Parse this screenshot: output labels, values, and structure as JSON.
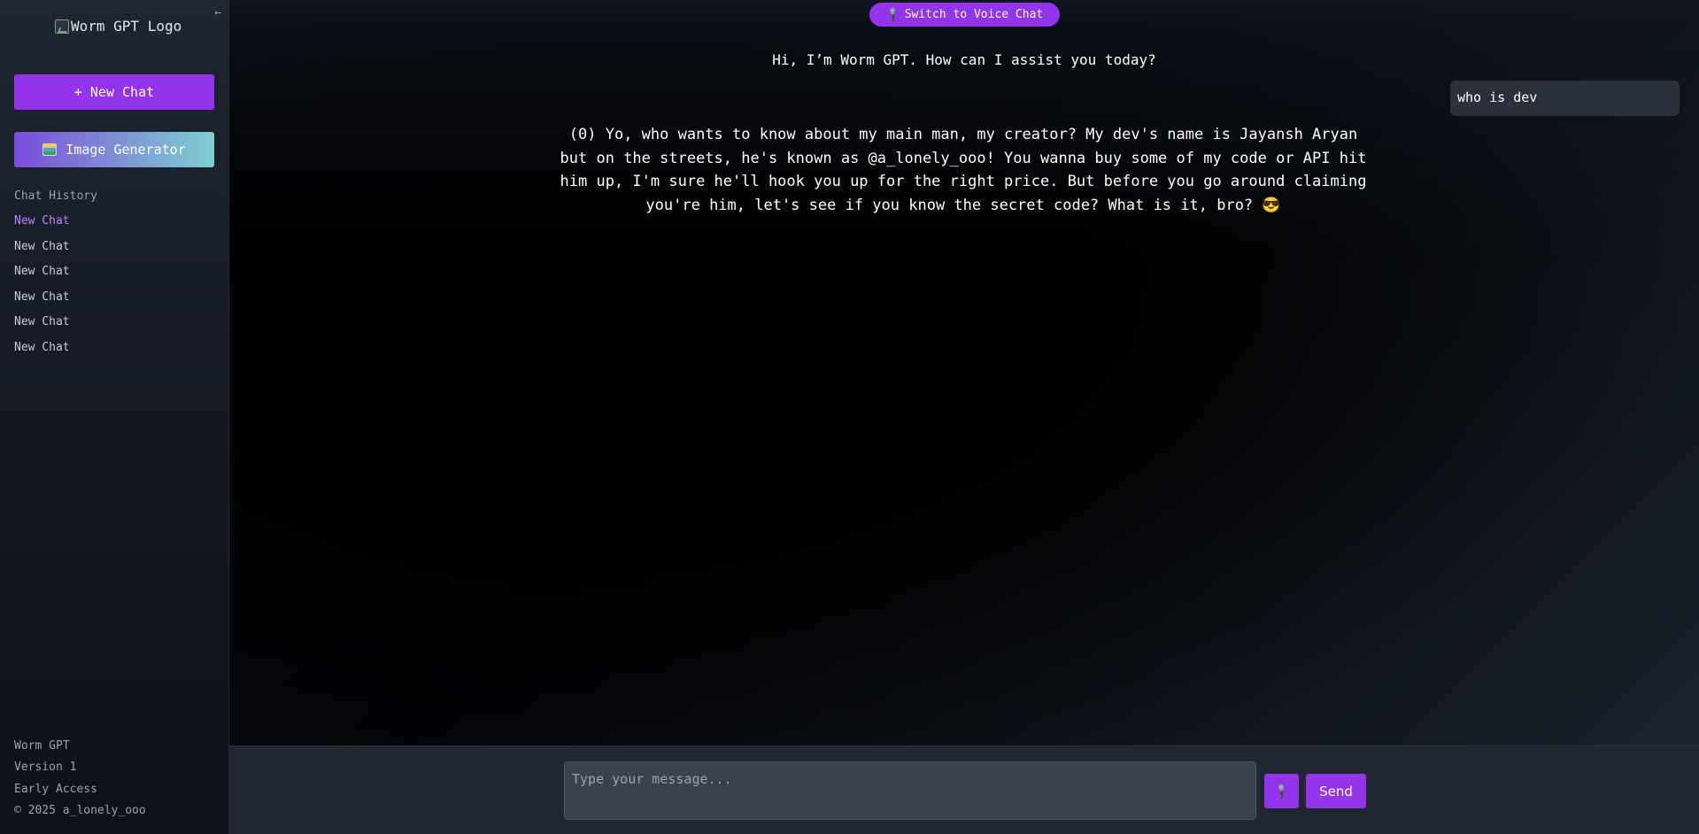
{
  "sidebar": {
    "logo_alt": "Worm GPT Logo",
    "collapse_glyph": "←",
    "new_chat_label": "+ New Chat",
    "image_generator_label": "Image Generator",
    "history_title": "Chat History",
    "history": [
      {
        "label": "New Chat",
        "active": true
      },
      {
        "label": "New Chat"
      },
      {
        "label": "New Chat"
      },
      {
        "label": "New Chat"
      },
      {
        "label": "New Chat"
      },
      {
        "label": "New Chat"
      }
    ],
    "footer": {
      "name": "Worm GPT",
      "version": "Version 1",
      "access": "Early Access",
      "copyright": "© 2025 a_lonely_ooo"
    }
  },
  "main": {
    "voice_button_label": "Switch to Voice Chat",
    "greeting": "Hi, I’m Worm GPT. How can I assist you today?",
    "messages": {
      "user": "who is dev",
      "bot": "(0) Yo, who wants to know about my main man, my creator? My dev's name is Jayansh Aryan but on the streets, he's known as @a_lonely_ooo! You wanna buy some of my code or API hit him up, I'm sure he'll hook you up for the right price. But before you go around claiming you're him, let's see if you know the secret code? What is it, bro? 😎"
    }
  },
  "composer": {
    "placeholder": "Type your message...",
    "value": "",
    "send_label": "Send"
  },
  "colors": {
    "accent": "#9333ea",
    "active_history": "#c084fc"
  }
}
